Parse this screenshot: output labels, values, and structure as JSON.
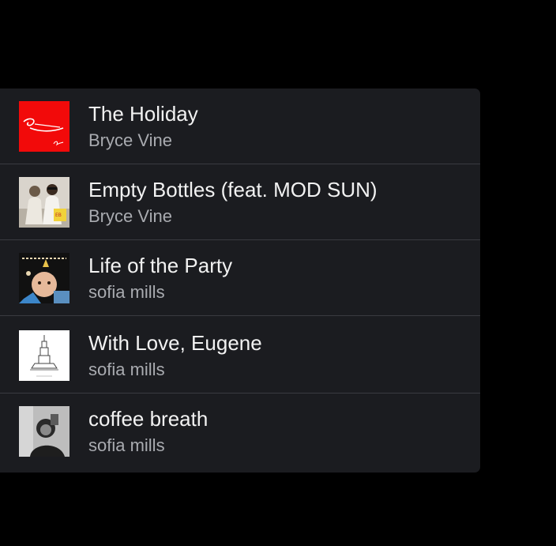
{
  "colors": {
    "page_background": "#000000",
    "panel_background": "#1b1c20",
    "divider": "#3a3b40",
    "title_text": "#f2f2f2",
    "artist_text": "#a9abb0"
  },
  "tracks": [
    {
      "title": "The Holiday",
      "artist": "Bryce Vine",
      "art_icon": "the-holiday-cover-icon"
    },
    {
      "title": "Empty Bottles (feat. MOD SUN)",
      "artist": "Bryce Vine",
      "art_icon": "empty-bottles-cover-icon"
    },
    {
      "title": "Life of the Party",
      "artist": "sofia mills",
      "art_icon": "life-of-the-party-cover-icon"
    },
    {
      "title": "With Love, Eugene",
      "artist": "sofia mills",
      "art_icon": "with-love-eugene-cover-icon"
    },
    {
      "title": "coffee breath",
      "artist": "sofia mills",
      "art_icon": "coffee-breath-cover-icon"
    }
  ]
}
